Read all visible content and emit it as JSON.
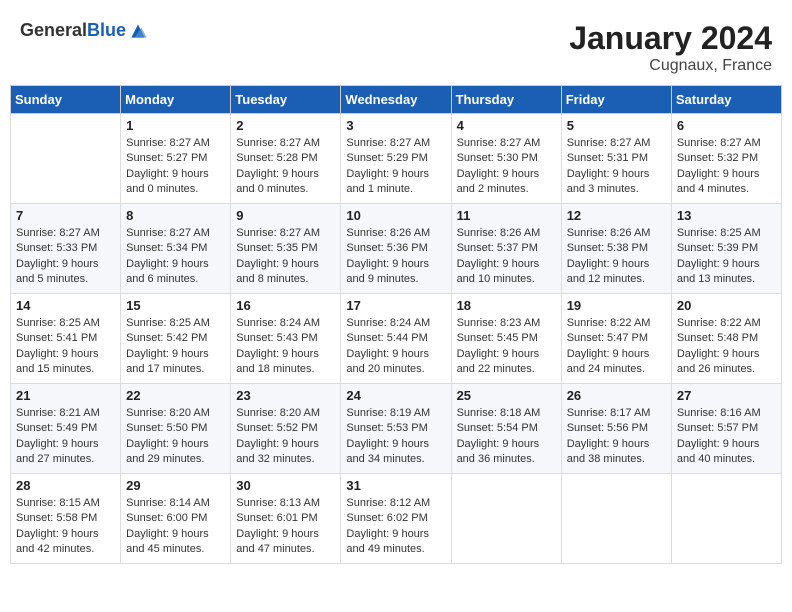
{
  "header": {
    "logo_general": "General",
    "logo_blue": "Blue",
    "month": "January 2024",
    "location": "Cugnaux, France"
  },
  "days_of_week": [
    "Sunday",
    "Monday",
    "Tuesday",
    "Wednesday",
    "Thursday",
    "Friday",
    "Saturday"
  ],
  "weeks": [
    [
      {
        "day": "",
        "content": ""
      },
      {
        "day": "1",
        "content": "Sunrise: 8:27 AM\nSunset: 5:27 PM\nDaylight: 9 hours\nand 0 minutes."
      },
      {
        "day": "2",
        "content": "Sunrise: 8:27 AM\nSunset: 5:28 PM\nDaylight: 9 hours\nand 0 minutes."
      },
      {
        "day": "3",
        "content": "Sunrise: 8:27 AM\nSunset: 5:29 PM\nDaylight: 9 hours\nand 1 minute."
      },
      {
        "day": "4",
        "content": "Sunrise: 8:27 AM\nSunset: 5:30 PM\nDaylight: 9 hours\nand 2 minutes."
      },
      {
        "day": "5",
        "content": "Sunrise: 8:27 AM\nSunset: 5:31 PM\nDaylight: 9 hours\nand 3 minutes."
      },
      {
        "day": "6",
        "content": "Sunrise: 8:27 AM\nSunset: 5:32 PM\nDaylight: 9 hours\nand 4 minutes."
      }
    ],
    [
      {
        "day": "7",
        "content": "Sunrise: 8:27 AM\nSunset: 5:33 PM\nDaylight: 9 hours\nand 5 minutes."
      },
      {
        "day": "8",
        "content": "Sunrise: 8:27 AM\nSunset: 5:34 PM\nDaylight: 9 hours\nand 6 minutes."
      },
      {
        "day": "9",
        "content": "Sunrise: 8:27 AM\nSunset: 5:35 PM\nDaylight: 9 hours\nand 8 minutes."
      },
      {
        "day": "10",
        "content": "Sunrise: 8:26 AM\nSunset: 5:36 PM\nDaylight: 9 hours\nand 9 minutes."
      },
      {
        "day": "11",
        "content": "Sunrise: 8:26 AM\nSunset: 5:37 PM\nDaylight: 9 hours\nand 10 minutes."
      },
      {
        "day": "12",
        "content": "Sunrise: 8:26 AM\nSunset: 5:38 PM\nDaylight: 9 hours\nand 12 minutes."
      },
      {
        "day": "13",
        "content": "Sunrise: 8:25 AM\nSunset: 5:39 PM\nDaylight: 9 hours\nand 13 minutes."
      }
    ],
    [
      {
        "day": "14",
        "content": "Sunrise: 8:25 AM\nSunset: 5:41 PM\nDaylight: 9 hours\nand 15 minutes."
      },
      {
        "day": "15",
        "content": "Sunrise: 8:25 AM\nSunset: 5:42 PM\nDaylight: 9 hours\nand 17 minutes."
      },
      {
        "day": "16",
        "content": "Sunrise: 8:24 AM\nSunset: 5:43 PM\nDaylight: 9 hours\nand 18 minutes."
      },
      {
        "day": "17",
        "content": "Sunrise: 8:24 AM\nSunset: 5:44 PM\nDaylight: 9 hours\nand 20 minutes."
      },
      {
        "day": "18",
        "content": "Sunrise: 8:23 AM\nSunset: 5:45 PM\nDaylight: 9 hours\nand 22 minutes."
      },
      {
        "day": "19",
        "content": "Sunrise: 8:22 AM\nSunset: 5:47 PM\nDaylight: 9 hours\nand 24 minutes."
      },
      {
        "day": "20",
        "content": "Sunrise: 8:22 AM\nSunset: 5:48 PM\nDaylight: 9 hours\nand 26 minutes."
      }
    ],
    [
      {
        "day": "21",
        "content": "Sunrise: 8:21 AM\nSunset: 5:49 PM\nDaylight: 9 hours\nand 27 minutes."
      },
      {
        "day": "22",
        "content": "Sunrise: 8:20 AM\nSunset: 5:50 PM\nDaylight: 9 hours\nand 29 minutes."
      },
      {
        "day": "23",
        "content": "Sunrise: 8:20 AM\nSunset: 5:52 PM\nDaylight: 9 hours\nand 32 minutes."
      },
      {
        "day": "24",
        "content": "Sunrise: 8:19 AM\nSunset: 5:53 PM\nDaylight: 9 hours\nand 34 minutes."
      },
      {
        "day": "25",
        "content": "Sunrise: 8:18 AM\nSunset: 5:54 PM\nDaylight: 9 hours\nand 36 minutes."
      },
      {
        "day": "26",
        "content": "Sunrise: 8:17 AM\nSunset: 5:56 PM\nDaylight: 9 hours\nand 38 minutes."
      },
      {
        "day": "27",
        "content": "Sunrise: 8:16 AM\nSunset: 5:57 PM\nDaylight: 9 hours\nand 40 minutes."
      }
    ],
    [
      {
        "day": "28",
        "content": "Sunrise: 8:15 AM\nSunset: 5:58 PM\nDaylight: 9 hours\nand 42 minutes."
      },
      {
        "day": "29",
        "content": "Sunrise: 8:14 AM\nSunset: 6:00 PM\nDaylight: 9 hours\nand 45 minutes."
      },
      {
        "day": "30",
        "content": "Sunrise: 8:13 AM\nSunset: 6:01 PM\nDaylight: 9 hours\nand 47 minutes."
      },
      {
        "day": "31",
        "content": "Sunrise: 8:12 AM\nSunset: 6:02 PM\nDaylight: 9 hours\nand 49 minutes."
      },
      {
        "day": "",
        "content": ""
      },
      {
        "day": "",
        "content": ""
      },
      {
        "day": "",
        "content": ""
      }
    ]
  ]
}
